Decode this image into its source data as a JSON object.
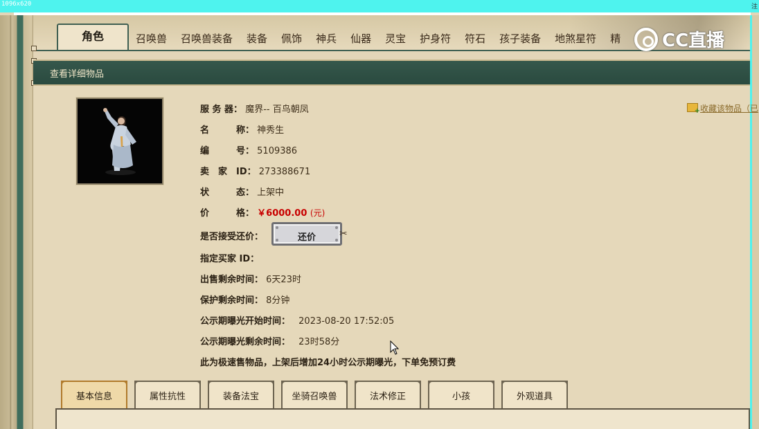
{
  "capture": {
    "dimension_label": "1096x620",
    "corner_label": "注"
  },
  "tabs": [
    {
      "label": "角色",
      "active": true
    },
    {
      "label": "召唤兽"
    },
    {
      "label": "召唤兽装备"
    },
    {
      "label": "装备"
    },
    {
      "label": "佩饰"
    },
    {
      "label": "神兵"
    },
    {
      "label": "仙器"
    },
    {
      "label": "灵宝"
    },
    {
      "label": "护身符"
    },
    {
      "label": "符石"
    },
    {
      "label": "孩子装备"
    },
    {
      "label": "地煞星符"
    },
    {
      "label": "精"
    }
  ],
  "watermark": {
    "text": "CC直播"
  },
  "section": {
    "title": "查看详细物品"
  },
  "favorite": {
    "label": "收藏该物品（已"
  },
  "details": {
    "server": {
      "label": "服 务 器：",
      "value": "魔界-- 百鸟朝凤"
    },
    "name": {
      "label": "名　　　称：",
      "value": "神秀生"
    },
    "number": {
      "label": "编　　　号：",
      "value": "5109386"
    },
    "seller": {
      "label": "卖　家　ID：",
      "value": "273388671"
    },
    "status": {
      "label": "状　　　态：",
      "value": "上架中"
    },
    "price": {
      "label": "价　　　格：",
      "value": "￥6000.00",
      "unit": "(元)"
    },
    "counter": {
      "label": "是否接受还价：",
      "button": "还价"
    },
    "buyer": {
      "label": "指定买家 ID："
    },
    "sale_remaining": {
      "label": "出售剩余时间：",
      "value": "6天23时"
    },
    "protect_remaining": {
      "label": "保护剩余时间：",
      "value": "8分钟"
    },
    "exposure_start": {
      "label": "公示期曝光开始时间：",
      "value": "2023-08-20 17:52:05"
    },
    "exposure_remaining": {
      "label": "公示期曝光剩余时间：",
      "value": "23时58分"
    },
    "note": "此为极速售物品，上架后增加24小时公示期曝光，下单免预订费"
  },
  "bottom_tabs": [
    {
      "label": "基本信息",
      "active": true
    },
    {
      "label": "属性抗性"
    },
    {
      "label": "装备法宝"
    },
    {
      "label": "坐骑召唤兽"
    },
    {
      "label": "法术修正"
    },
    {
      "label": "小孩"
    },
    {
      "label": "外观道具"
    }
  ],
  "colors": {
    "accent_green": "#2f5246",
    "price_red": "#c80000",
    "capture_cyan": "#4ef3ee"
  },
  "icons": {
    "favorite": "folder-add-icon",
    "cursor": "mouse-pointer-icon"
  }
}
